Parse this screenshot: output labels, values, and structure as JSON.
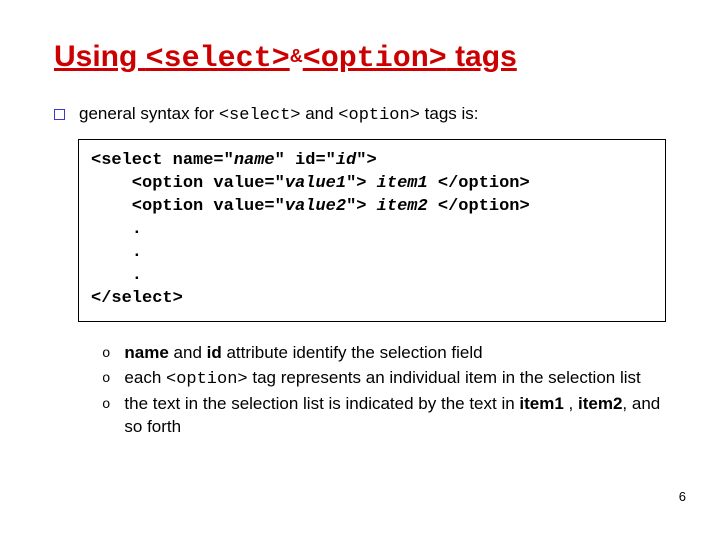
{
  "title": {
    "p1": "Using ",
    "p2": "<select>",
    "amp": " & ",
    "p3": "<option>",
    "p4": " tags"
  },
  "top_bullet": {
    "pre": "general syntax for ",
    "c1": "<select>",
    "mid": " and ",
    "c2": "<option>",
    "post": " tags is:"
  },
  "code": {
    "l1a": "<select name=\"",
    "l1b": "name",
    "l1c": "\" id=\"",
    "l1d": "id",
    "l1e": "\">",
    "l2a": "    <option value=\"",
    "l2b": "value1",
    "l2c": "\"> ",
    "l2d": "item1",
    "l2e": " </option>",
    "l3a": "    <option value=\"",
    "l3b": "value2",
    "l3c": "\"> ",
    "l3d": "item2",
    "l3e": " </option>",
    "dots": "    .\n    .\n    .",
    "l7": "</select>"
  },
  "subs": [
    {
      "b1": "name",
      "t1": " and ",
      "b2": "id",
      "t2": " attribute identify the selection field"
    },
    {
      "t1": "each ",
      "c1": "<option>",
      "t2": " tag represents an individual item in the selection list"
    },
    {
      "t1": "the text in the selection list is indicated by the text in ",
      "b1": "item1",
      "t2": " , ",
      "b2": "item2",
      "t3": ", and so forth"
    }
  ],
  "page": "6"
}
